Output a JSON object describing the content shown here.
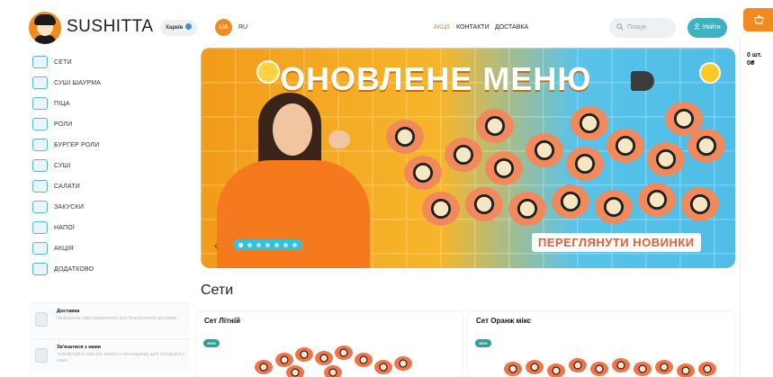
{
  "header": {
    "brand": "SUSHITTA",
    "city": "Харків",
    "lang_active": "UA",
    "lang_other": "RU",
    "nav": [
      "АКЦІЇ",
      "КОНТАКТИ",
      "ДОСТАВКА"
    ],
    "search_placeholder": "Пошук",
    "login_label": "Увійти",
    "accent_color": "#f18a1f",
    "login_color": "#3fb2c1"
  },
  "cart": {
    "count": "0 шт.",
    "sum": "0₴",
    "icon": "basket-icon"
  },
  "sidebar": {
    "items": [
      {
        "label": "СЕТИ",
        "icon": "sets-icon"
      },
      {
        "label": "СУШІ ШАУРМА",
        "icon": "shawarma-icon"
      },
      {
        "label": "ПІЦА",
        "icon": "pizza-icon"
      },
      {
        "label": "РОЛИ",
        "icon": "rolls-icon"
      },
      {
        "label": "БУРГЕР РОЛИ",
        "icon": "burger-icon"
      },
      {
        "label": "СУШІ",
        "icon": "sushi-icon"
      },
      {
        "label": "САЛАТИ",
        "icon": "salad-icon"
      },
      {
        "label": "ЗАКУСКИ",
        "icon": "snacks-icon"
      },
      {
        "label": "НАПОЇ",
        "icon": "drinks-icon"
      },
      {
        "label": "АКЦІЯ",
        "icon": "promo-icon"
      },
      {
        "label": "ДОДАТКОВО",
        "icon": "extra-icon"
      }
    ],
    "info": [
      {
        "title": "Доставка",
        "text": "Мінімальна сума замовлення для безкоштовної доставки"
      },
      {
        "title": "Зв'язатися з нами",
        "text": "Телефонуйте нам або пишіть у месенджери щоб зв'язатися з нами"
      }
    ]
  },
  "banner": {
    "headline": "ОНОВЛЕНЕ МЕНЮ",
    "cta": "ПЕРЕГЛЯНУТИ НОВИНКИ",
    "slides": 7,
    "active_slide": 1
  },
  "section": {
    "title": "Сети"
  },
  "products": [
    {
      "name": "Сет Літній",
      "badge": "NEW"
    },
    {
      "name": "Сет Оранж мікс",
      "badge": "NEW"
    }
  ]
}
